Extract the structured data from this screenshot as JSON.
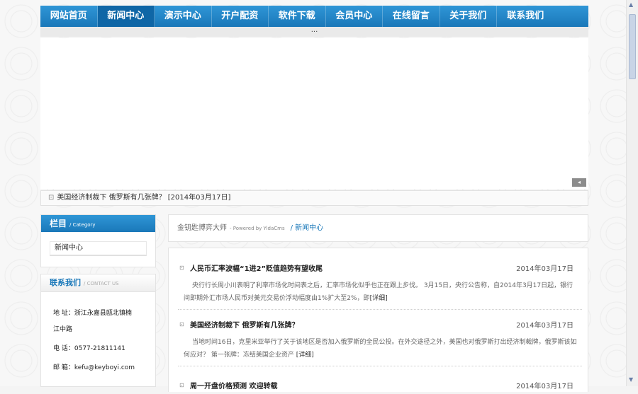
{
  "nav": {
    "items": [
      {
        "label": "网站首页"
      },
      {
        "label": "新闻中心",
        "active": true
      },
      {
        "label": "演示中心"
      },
      {
        "label": "开户配资"
      },
      {
        "label": "软件下载"
      },
      {
        "label": "会员中心"
      },
      {
        "label": "在线留言"
      },
      {
        "label": "关于我们"
      },
      {
        "label": "联系我们"
      }
    ],
    "sub_text": "..."
  },
  "banner": {
    "button_icon": "left-arrow-icon",
    "button_glyph": "◂"
  },
  "ticker": {
    "icon": "square-bullet-icon",
    "text": "美国经济制裁下 俄罗斯有几张牌？ [2014年03月17日]"
  },
  "sidebar": {
    "category": {
      "title": "栏目",
      "subtitle": "/ Category",
      "items": [
        {
          "label": "新闻中心"
        }
      ]
    },
    "contact": {
      "title": "联系我们",
      "subtitle": "/ CONTACT US",
      "lines": [
        "地 址：浙江永嘉县瓯北镇楠",
        "江中路",
        "电 话：0577-21811141",
        "邮 箱：kefu@keyboyi.com"
      ]
    }
  },
  "breadcrumb": {
    "site": "金钥匙博弈大师",
    "powered": "- Powered by YidaCms",
    "current": "/ 新闻中心"
  },
  "articles": [
    {
      "title": "人民币汇率波幅“1进2”贬值趋势有望收尾",
      "date": "2014年03月17日",
      "summary": "央行行长周小川表明了利率市场化时间表之后，汇率市场化似乎也正在跟上步伐。      3月15日，央行公告称，自2014年3月17日起，银行间即期外汇市场人民币对美元交易价浮动幅度由1%扩大至2%，即",
      "more": "[详细]"
    },
    {
      "title": "美国经济制裁下 俄罗斯有几张牌？",
      "date": "2014年03月17日",
      "summary": "当地时间16日，克里米亚举行了关于该地区是否加入俄罗斯的全民公投。在外交途径之外，美国也对俄罗斯打出经济制裁牌，俄罗斯该如何应对？ 第一张牌：冻结美国企业资产 ",
      "more": "[详细]"
    },
    {
      "title": "周一开盘价格预测 欢迎转载",
      "date": "2014年03月17日",
      "summary": "",
      "more": ""
    }
  ],
  "scrollbar": {
    "up_glyph": "▲",
    "down_glyph": "▼"
  }
}
